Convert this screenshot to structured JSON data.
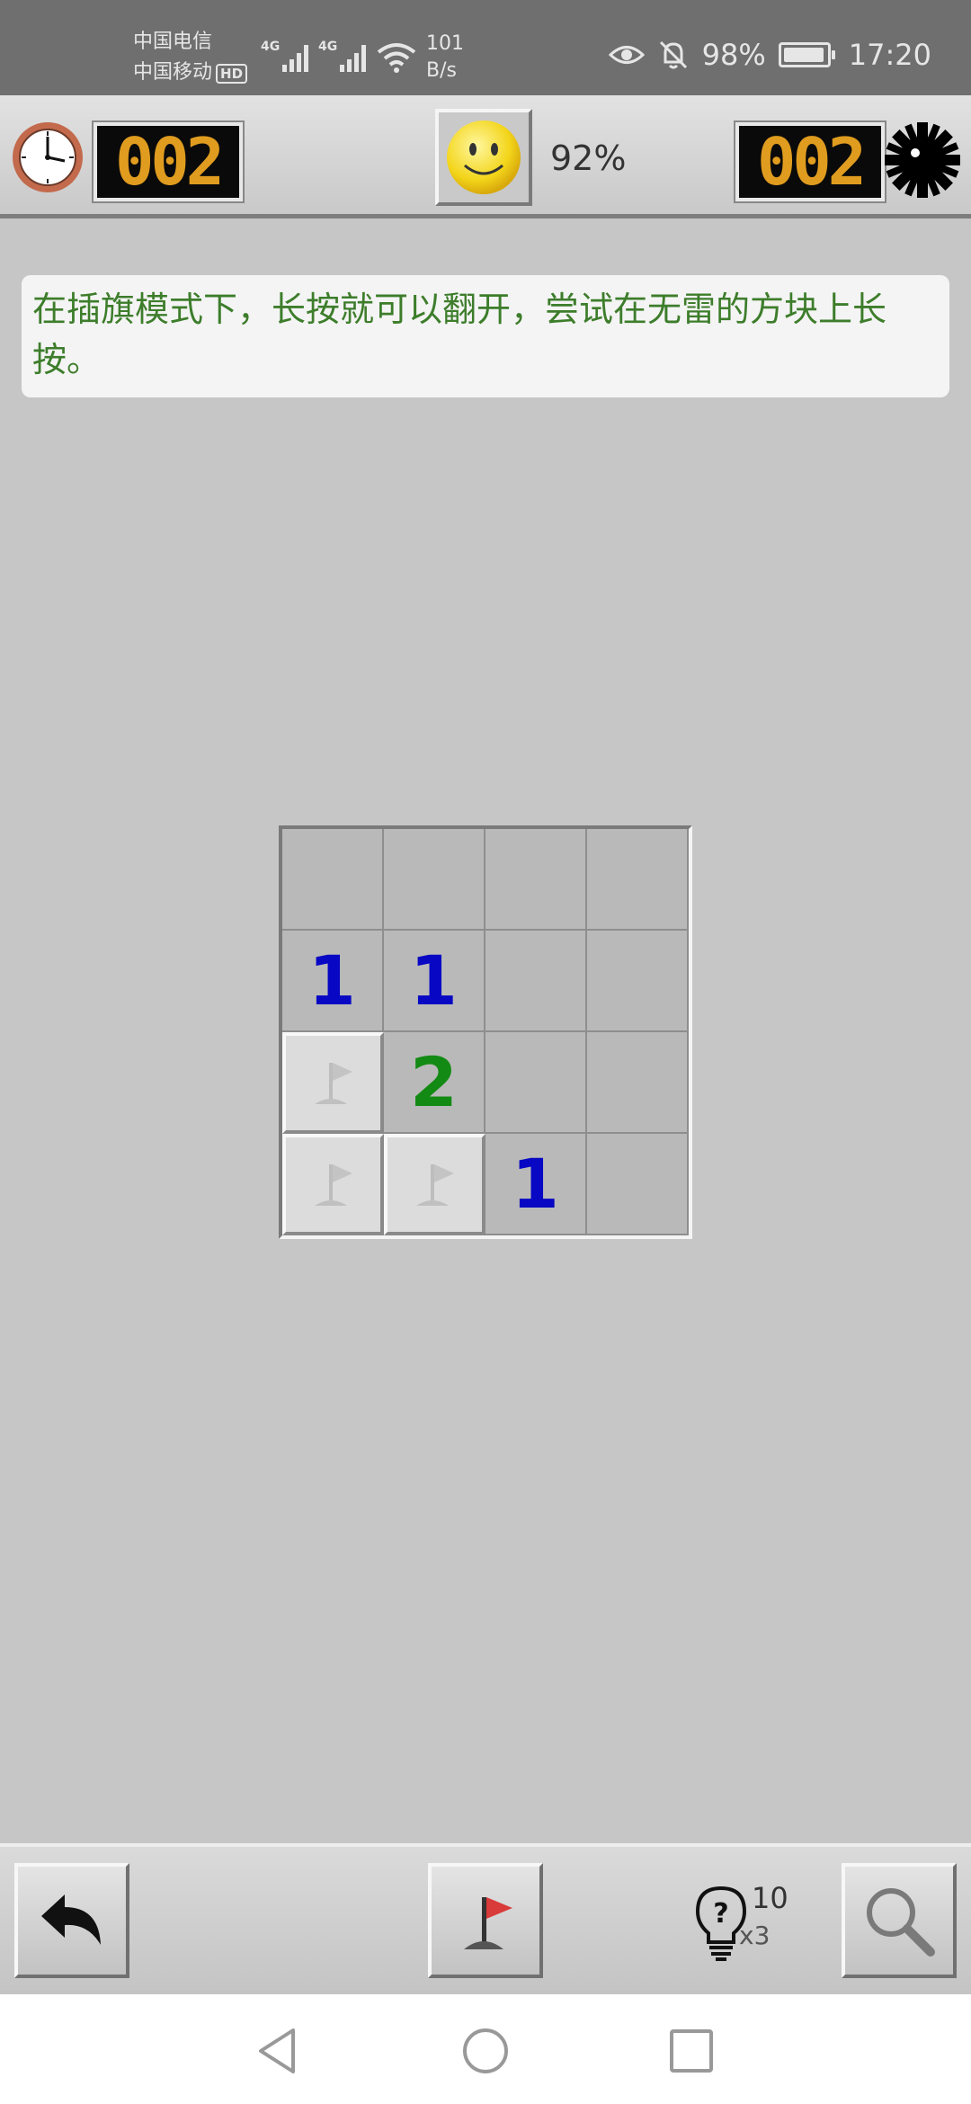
{
  "status_bar": {
    "carrier_1": "中国电信",
    "carrier_2": "中国移动",
    "hd_badge": "HD",
    "network_1": "4G",
    "network_2": "4G",
    "speed_value": "101",
    "speed_unit": "B/s",
    "battery": "98%",
    "battery_level": 0.98,
    "time": "17:20"
  },
  "game_header": {
    "timer": "002",
    "percent": "92%",
    "mines_left": "002"
  },
  "hint_text": "在插旗模式下，长按就可以翻开，尝试在无雷的方块上长按。",
  "board": {
    "rows": 4,
    "cols": 4,
    "cells": [
      [
        "",
        "",
        "",
        ""
      ],
      [
        "1",
        "1",
        "",
        ""
      ],
      [
        "F",
        "2",
        "",
        ""
      ],
      [
        "F",
        "F",
        "1",
        ""
      ]
    ]
  },
  "toolbar": {
    "hint_count": "10",
    "hint_multiplier": "x3"
  },
  "colors": {
    "counter_digits": "#e09c1f",
    "number_1": "#0707c4",
    "number_2": "#138a13",
    "hint_text": "#3d7d2b",
    "flag": "#d93a3a"
  }
}
